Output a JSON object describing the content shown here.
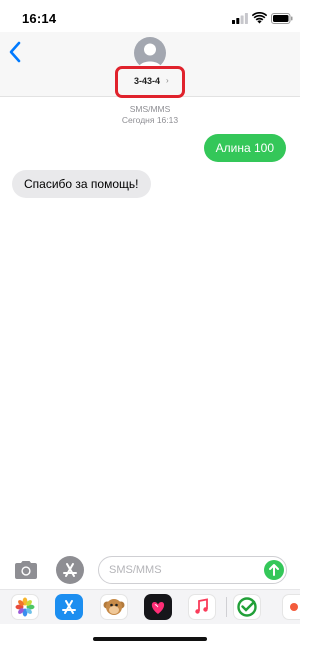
{
  "status_bar": {
    "time": "16:14",
    "icons": [
      "cellular-signal-icon",
      "wifi-icon",
      "battery-icon"
    ]
  },
  "header": {
    "back_icon": "chevron-left-icon",
    "avatar_icon": "person-silhouette-icon",
    "contact_name": "3-43-4",
    "contact_chevron": "›"
  },
  "thread": {
    "service": "SMS/MMS",
    "date": "Сегодня 16:13",
    "messages": [
      {
        "direction": "outgoing",
        "text": "Алина 100",
        "color": "#34c759"
      },
      {
        "direction": "incoming",
        "text": "Спасибо за помощь!",
        "color": "#e9e9eb"
      }
    ]
  },
  "compose": {
    "camera_icon": "camera-icon",
    "apps_icon": "app-store-icon",
    "placeholder": "SMS/MMS",
    "send_icon": "arrow-up-icon"
  },
  "app_tray": [
    "photos-icon",
    "app-store-icon",
    "memoji-icon",
    "digital-touch-icon",
    "music-icon",
    "sberbank-icon",
    "more-apps-icon"
  ],
  "colors": {
    "accent": "#007aff",
    "sent_bubble": "#34c759",
    "received_bubble": "#e9e9eb",
    "highlight_box": "#e0222c"
  }
}
